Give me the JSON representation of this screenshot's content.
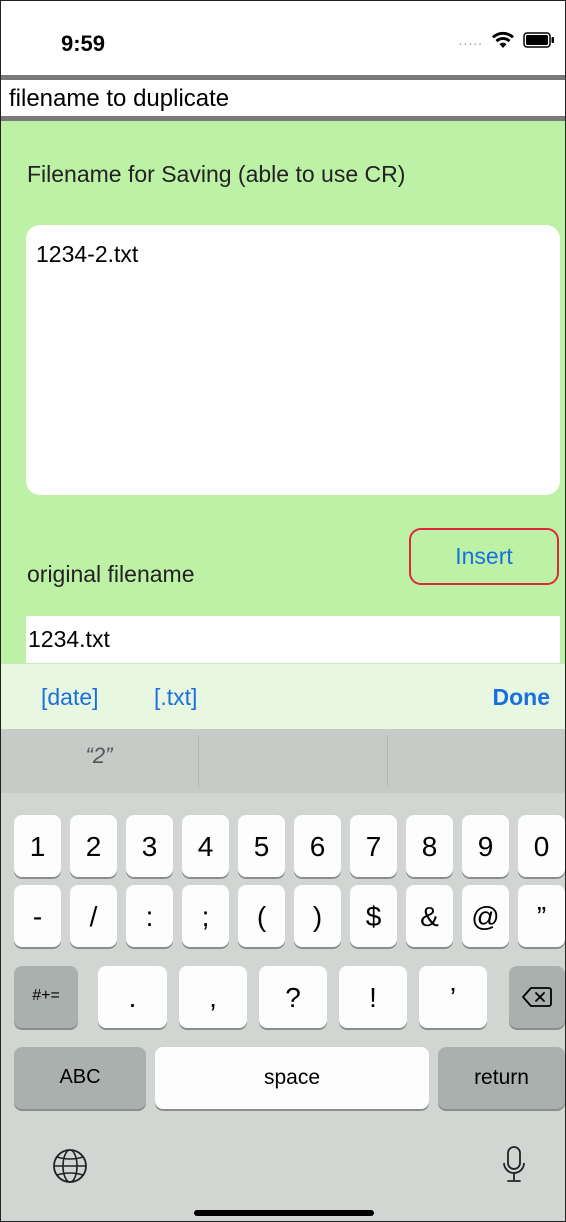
{
  "status_bar": {
    "time": "9:59",
    "signal": "....."
  },
  "title": "filename to duplicate",
  "form": {
    "save_label": "Filename for Saving (able to use CR)",
    "save_value": "1234-2.txt",
    "insert_label": "Insert",
    "original_label": "original filename",
    "original_value": "1234.txt"
  },
  "accessory": {
    "date_label": "[date]",
    "txt_label": "[.txt]",
    "done_label": "Done"
  },
  "keyboard": {
    "suggestions": [
      "“2”",
      "",
      ""
    ],
    "row1": [
      "1",
      "2",
      "3",
      "4",
      "5",
      "6",
      "7",
      "8",
      "9",
      "0"
    ],
    "row2": [
      "-",
      "/",
      ":",
      ";",
      "(",
      ")",
      "$",
      "&",
      "@",
      "”"
    ],
    "row3_mode": "#+=",
    "row3": [
      ".",
      ",",
      "?",
      "!",
      "’"
    ],
    "abc": "ABC",
    "space": "space",
    "return": "return"
  },
  "colors": {
    "green_bg": "#bdf2a6",
    "accent_blue": "#1a6fe0",
    "insert_border": "#e0263a",
    "keyboard_bg": "#d1d6d3"
  },
  "icons": [
    "wifi-icon",
    "battery-icon",
    "backspace-icon",
    "globe-icon",
    "microphone-icon"
  ]
}
